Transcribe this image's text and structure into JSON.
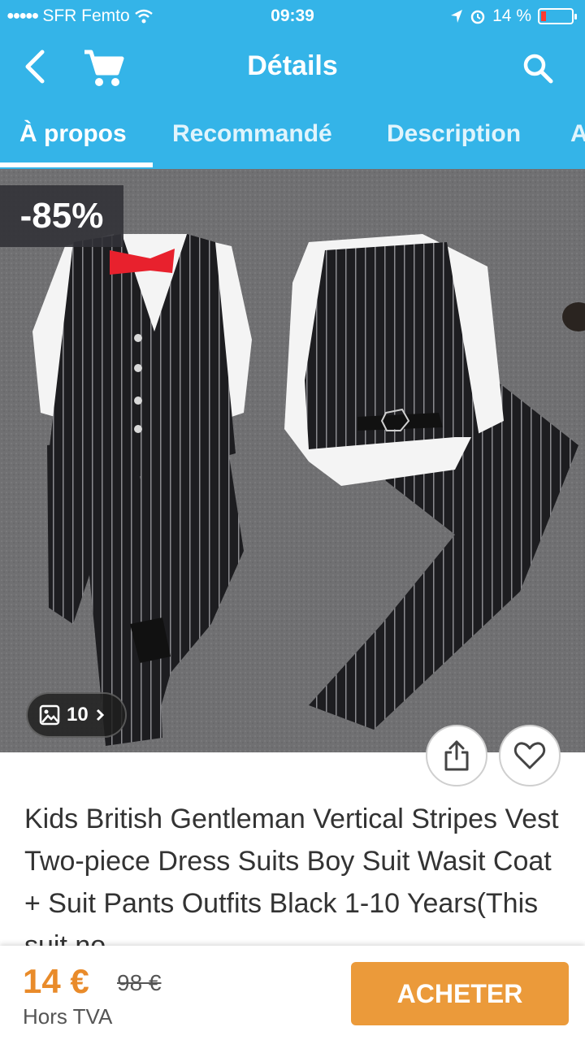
{
  "status_bar": {
    "carrier": "SFR Femto",
    "time": "09:39",
    "battery": "14 %",
    "battery_level": 0.14
  },
  "header": {
    "title": "Détails",
    "icons": [
      "back-icon",
      "cart-icon",
      "search-icon"
    ]
  },
  "tabs": [
    {
      "label": "À propos",
      "active": true
    },
    {
      "label": "Recommandé",
      "active": false
    },
    {
      "label": "Description",
      "active": false
    },
    {
      "label": "A",
      "active": false
    }
  ],
  "product": {
    "discount": "-85%",
    "image_count": "10",
    "title": "Kids British Gentleman Vertical Stripes Vest Two-piece Dress Suits Boy Suit Wasit Coat + Suit Pants Outfits Black 1-10 Years(This suit no"
  },
  "purchase": {
    "price": "14 €",
    "old_price": "98 €",
    "tax_note": "Hors TVA",
    "buy_label": "ACHETER"
  },
  "colors": {
    "primary": "#34b4e8",
    "accent": "#e98b2a",
    "button": "#eb9a3a"
  }
}
